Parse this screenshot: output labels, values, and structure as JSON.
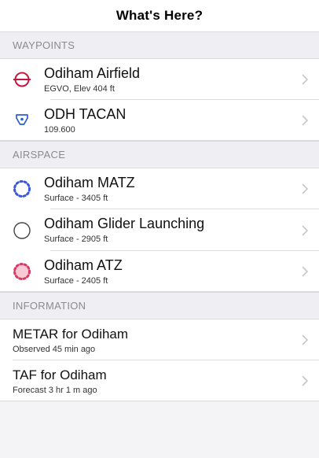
{
  "nav": {
    "title": "What's Here?"
  },
  "sections": [
    {
      "header": "WAYPOINTS",
      "rows": [
        {
          "icon": "airfield-icon",
          "title": "Odiham Airfield",
          "subtitle": "EGVO, Elev 404 ft"
        },
        {
          "icon": "tacan-icon",
          "title": "ODH TACAN",
          "subtitle": "109.600"
        }
      ]
    },
    {
      "header": "AIRSPACE",
      "rows": [
        {
          "icon": "matz-icon",
          "title": "Odiham MATZ",
          "subtitle": "Surface - 3405 ft"
        },
        {
          "icon": "glider-icon",
          "title": "Odiham Glider Launching",
          "subtitle": "Surface - 2905 ft"
        },
        {
          "icon": "atz-icon",
          "title": "Odiham ATZ",
          "subtitle": "Surface - 2405 ft"
        }
      ]
    },
    {
      "header": "INFORMATION",
      "rows": [
        {
          "title": "METAR for Odiham",
          "subtitle": "Observed 45 min ago"
        },
        {
          "title": "TAF for Odiham",
          "subtitle": "Forecast 3 hr 1 m ago"
        }
      ]
    }
  ],
  "colors": {
    "airfield": "#c8173c",
    "tacan": "#2a5fc9",
    "matz": "#3a57d6",
    "atz": "#d83a63",
    "chevron": "#c7c7cc"
  }
}
